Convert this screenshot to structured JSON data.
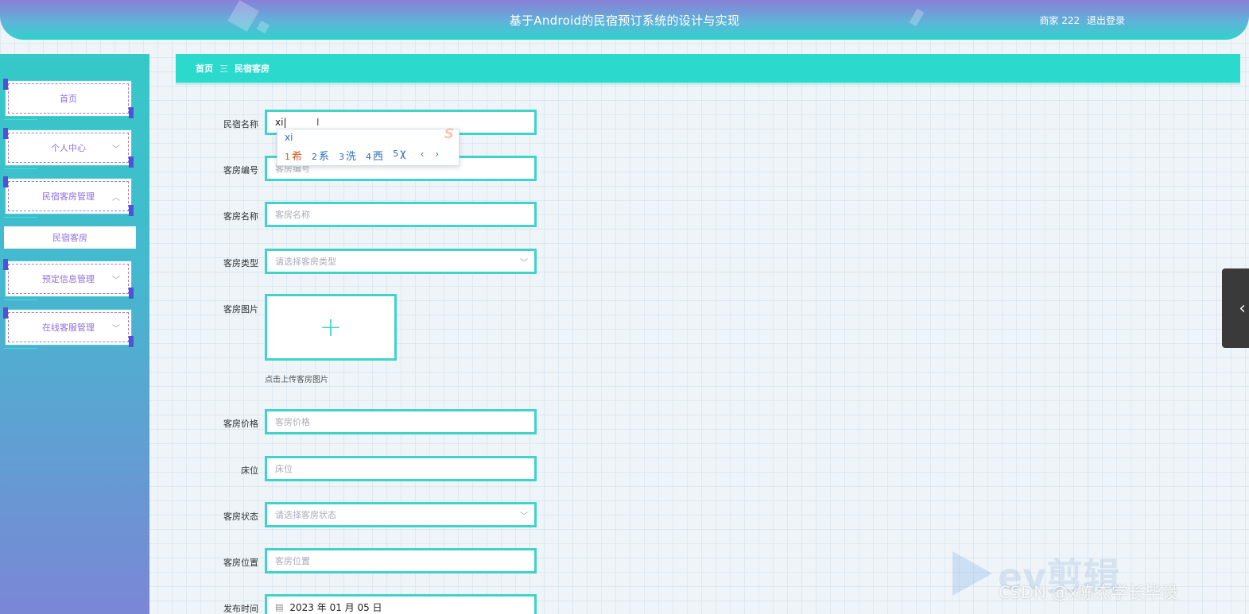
{
  "header": {
    "title": "基于Android的民宿预订系统的设计与实现",
    "user_label": "商家 222",
    "logout_label": "退出登录"
  },
  "sidebar": {
    "items": [
      {
        "label": "首页",
        "arrow": ""
      },
      {
        "label": "个人中心",
        "arrow": "﹀"
      },
      {
        "label": "民宿客房管理",
        "arrow": "︿"
      },
      {
        "label": "预定信息管理",
        "arrow": "﹀"
      },
      {
        "label": "在线客服管理",
        "arrow": "﹀"
      }
    ],
    "sub_item": "民宿客房"
  },
  "breadcrumb": {
    "home": "首页",
    "separator": "三",
    "current": "民宿客房"
  },
  "form": {
    "homestay_name": {
      "label": "民宿名称",
      "value": "xi"
    },
    "room_number": {
      "label": "客房编号",
      "placeholder": "客房编号"
    },
    "room_name": {
      "label": "客房名称",
      "placeholder": "客房名称"
    },
    "room_type": {
      "label": "客房类型",
      "placeholder": "请选择客房类型"
    },
    "room_image": {
      "label": "客房图片",
      "upload_symbol": "+",
      "hint": "点击上传客房图片"
    },
    "room_price": {
      "label": "客房价格",
      "placeholder": "客房价格"
    },
    "bed": {
      "label": "床位",
      "placeholder": "床位"
    },
    "room_status": {
      "label": "客房状态",
      "placeholder": "请选择客房状态"
    },
    "room_location": {
      "label": "客房位置",
      "placeholder": "客房位置"
    },
    "publish_time": {
      "label": "发布时间",
      "value": "2023 年 01 月 05 日"
    }
  },
  "ime": {
    "pinyin": "xi",
    "candidates": [
      {
        "num": "1",
        "text": "希"
      },
      {
        "num": "2",
        "text": "系"
      },
      {
        "num": "3",
        "text": "洗"
      },
      {
        "num": "4",
        "text": "西"
      },
      {
        "num": "5",
        "text": "χ"
      }
    ],
    "nav": "‹ ›",
    "logo": "S"
  },
  "drawer_handle": {
    "icon": "‹"
  },
  "watermarks": {
    "brand": "ev剪辑",
    "csdn": "CSDN @x陈杰学长毕设"
  },
  "colors": {
    "accent": "#2cdacd",
    "sidebar_text": "#8e6fd8",
    "header_gradient_top": "#8a7fd8"
  },
  "icons": {
    "calendar": "calendar-icon",
    "chevron_down": "chevron-down-icon",
    "chevron_left": "chevron-left-icon",
    "plus": "plus-icon"
  }
}
